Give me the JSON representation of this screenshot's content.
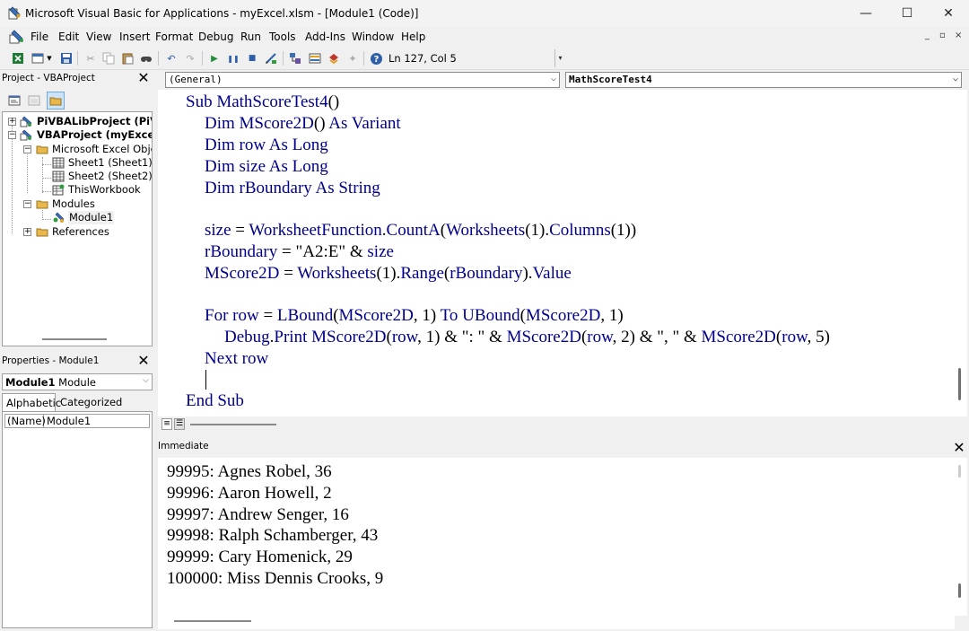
{
  "window": {
    "title": "Microsoft Visual Basic for Applications - myExcel.xlsm - [Module1 (Code)]",
    "min_glyph": "—",
    "max_glyph": "☐",
    "close_glyph": "✕"
  },
  "menu": {
    "items": [
      "File",
      "Edit",
      "View",
      "Insert",
      "Format",
      "Debug",
      "Run",
      "Tools",
      "Add-Ins",
      "Window",
      "Help"
    ],
    "mdi_min": "_",
    "mdi_restore": "▫",
    "mdi_close": "×"
  },
  "toolbar": {
    "position": "Ln 127, Col 5"
  },
  "project": {
    "header": "Project - VBAProject",
    "tree": {
      "pivba": "PiVBALibProject (PiVB",
      "vbaproject": "VBAProject (myExcel.",
      "excel_objects": "Microsoft Excel Object",
      "sheet1": "Sheet1 (Sheet1)",
      "sheet2": "Sheet2 (Sheet2)",
      "thisworkbook": "ThisWorkbook",
      "modules": "Modules",
      "module1": "Module1",
      "references": "References"
    }
  },
  "properties": {
    "header": "Properties - Module1",
    "combo_name": "Module1",
    "combo_type": "Module",
    "tab_alphabetic": "Alphabetic",
    "tab_categorized": "Categorized",
    "prop_name": "(Name)",
    "prop_value": "Module1"
  },
  "code": {
    "object_combo": "(General)",
    "proc_combo": "MathScoreTest4",
    "lines": [
      {
        "k": "Sub ",
        "t": "",
        "k2": "MathScoreTest4",
        "t2": "()"
      },
      {
        "k": "Dim ",
        "t": "",
        "k2": "MScore2D",
        "t2": "() ",
        "k3": "As Variant"
      },
      {
        "k": "Dim row As Long"
      },
      {
        "k": "Dim size As Long"
      },
      {
        "k": "Dim rBoundary As String"
      },
      {},
      {
        "a": "size",
        "b": " = ",
        "c": "WorksheetFunction",
        "d": ".",
        "e": "CountA",
        "f": "(",
        "g": "Worksheets",
        "h": "(1).",
        "i": "Columns",
        "j": "(1))"
      },
      {
        "a": "rBoundary",
        "b": " = \"A2:E\" & ",
        "c": "size"
      },
      {
        "a": "MScore2D",
        "b": " = ",
        "c": "Worksheets",
        "d": "(1).",
        "e": "Range",
        "f": "(",
        "g": "rBoundary",
        "h": ").",
        "i": "Value"
      },
      {},
      {
        "a": "For row",
        "b": " = ",
        "c": "LBound",
        "d": "(",
        "e": "MScore2D",
        "f": ", 1) ",
        "g": "To UBound",
        "h": "(",
        "i": "MScore2D",
        "j": ", 1)"
      },
      {
        "a": "Debug",
        "b": ".",
        "c": "Print MScore2D",
        "d": "(",
        "e": "row",
        "f": ", 1) & \": \" & ",
        "g": "MScore2D",
        "h": "(",
        "i": "row",
        "j": ", 2) & \", \" & ",
        "k": "MScore2D",
        "l": "(",
        "m": "row",
        "n": ", 5)"
      },
      {
        "a": "Next row"
      },
      {},
      {
        "a": "End Sub"
      }
    ]
  },
  "immediate": {
    "header": "Immediate",
    "lines": [
      "99995: Agnes Robel, 36",
      "99996: Aaron Howell, 2",
      "99997: Andrew Senger, 16",
      "99998: Ralph Schamberger, 43",
      "99999: Cary Homenick, 29",
      "100000: Miss Dennis Crooks, 9"
    ]
  },
  "colors": {
    "keyword": "#00008b",
    "text": "#000000"
  }
}
